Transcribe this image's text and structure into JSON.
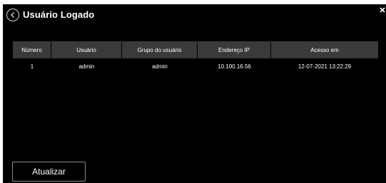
{
  "dialog": {
    "title": "Usuário Logado",
    "back_icon": "chevron-left-circle-icon",
    "close_icon": "close-icon"
  },
  "table": {
    "columns": [
      "Número",
      "Usuário",
      "Grupo do usuário",
      "Endereço IP",
      "Acesso em"
    ],
    "rows": [
      [
        "1",
        "admin",
        "admin",
        "10.100.16.56",
        "12-07-2021 13:22:29"
      ]
    ]
  },
  "footer": {
    "refresh_label": "Atualizar"
  },
  "colors": {
    "background": "#000000",
    "header_cell": "#3a3a3a",
    "text": "#ffffff",
    "button_border": "#8a8a8a"
  }
}
